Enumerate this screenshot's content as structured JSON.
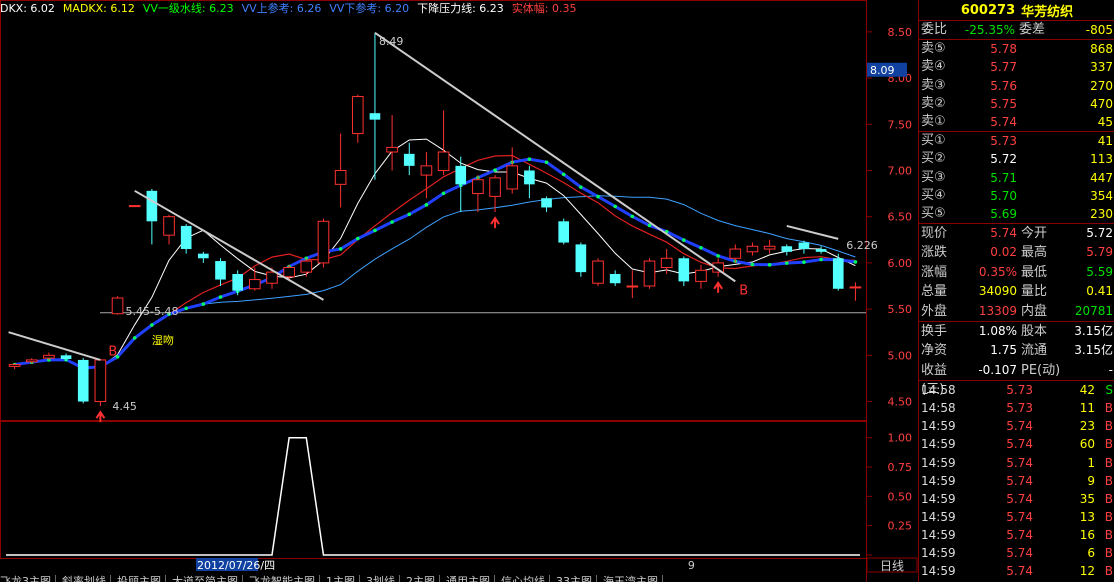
{
  "indicators": [
    {
      "label": "DKX: 6.02",
      "color": "#ffffff"
    },
    {
      "label": "MADKX: 6.12",
      "color": "#ffff00"
    },
    {
      "label": "VV一级水线: 6.23",
      "color": "#00ff00"
    },
    {
      "label": "VV上参考: 6.26",
      "color": "#4080ff"
    },
    {
      "label": "VV下参考: 6.20",
      "color": "#4080ff"
    },
    {
      "label": "下降压力线: 6.23",
      "color": "#ffffff"
    },
    {
      "label": "实体幅: 0.35",
      "color": "#ff4040"
    }
  ],
  "chart_data": {
    "type": "candlestick",
    "y_axis_ticks": [
      "8.50",
      "8.00",
      "7.50",
      "7.00",
      "6.50",
      "6.00",
      "5.50",
      "5.00",
      "4.50"
    ],
    "ylim": [
      4.3,
      8.65
    ],
    "current_price_marker": "8.09",
    "candles": [
      {
        "o": 4.88,
        "c": 4.9,
        "h": 4.91,
        "l": 4.85
      },
      {
        "o": 4.93,
        "c": 4.95,
        "h": 4.97,
        "l": 4.91
      },
      {
        "o": 4.97,
        "c": 5.0,
        "h": 5.03,
        "l": 4.95
      },
      {
        "o": 5.0,
        "c": 4.96,
        "h": 5.02,
        "l": 4.94
      },
      {
        "o": 4.95,
        "c": 4.5,
        "h": 4.97,
        "l": 4.48
      },
      {
        "o": 4.5,
        "c": 4.95,
        "h": 4.96,
        "l": 4.45
      },
      {
        "o": 5.45,
        "c": 5.62,
        "h": 5.64,
        "l": 5.44
      },
      {
        "o": 6.62,
        "c": 6.62,
        "h": 6.62,
        "l": 6.62
      },
      {
        "o": 6.78,
        "c": 6.45,
        "h": 6.8,
        "l": 6.2
      },
      {
        "o": 6.3,
        "c": 6.5,
        "h": 6.52,
        "l": 6.2
      },
      {
        "o": 6.4,
        "c": 6.15,
        "h": 6.42,
        "l": 6.1
      },
      {
        "o": 6.1,
        "c": 6.05,
        "h": 6.12,
        "l": 6.0
      },
      {
        "o": 6.02,
        "c": 5.82,
        "h": 6.05,
        "l": 5.75
      },
      {
        "o": 5.88,
        "c": 5.7,
        "h": 5.92,
        "l": 5.65
      },
      {
        "o": 5.72,
        "c": 5.82,
        "h": 5.95,
        "l": 5.7
      },
      {
        "o": 5.78,
        "c": 5.9,
        "h": 5.95,
        "l": 5.72
      },
      {
        "o": 5.85,
        "c": 5.95,
        "h": 5.98,
        "l": 5.8
      },
      {
        "o": 5.9,
        "c": 6.02,
        "h": 6.05,
        "l": 5.85
      },
      {
        "o": 6.0,
        "c": 6.45,
        "h": 6.48,
        "l": 5.95
      },
      {
        "o": 6.85,
        "c": 7.0,
        "h": 7.4,
        "l": 6.6
      },
      {
        "o": 7.4,
        "c": 7.8,
        "h": 7.82,
        "l": 7.3
      },
      {
        "o": 7.62,
        "c": 7.55,
        "h": 8.49,
        "l": 6.9
      },
      {
        "o": 7.2,
        "c": 7.25,
        "h": 7.6,
        "l": 7.0
      },
      {
        "o": 7.18,
        "c": 7.05,
        "h": 7.3,
        "l": 6.95
      },
      {
        "o": 6.95,
        "c": 7.05,
        "h": 7.2,
        "l": 6.7
      },
      {
        "o": 7.0,
        "c": 7.2,
        "h": 7.65,
        "l": 6.95
      },
      {
        "o": 7.05,
        "c": 6.85,
        "h": 7.15,
        "l": 6.55
      },
      {
        "o": 6.75,
        "c": 6.9,
        "h": 6.95,
        "l": 6.55
      },
      {
        "o": 6.72,
        "c": 6.92,
        "h": 6.95,
        "l": 6.55
      },
      {
        "o": 6.8,
        "c": 7.05,
        "h": 7.25,
        "l": 6.75
      },
      {
        "o": 7.0,
        "c": 6.85,
        "h": 7.05,
        "l": 6.7
      },
      {
        "o": 6.7,
        "c": 6.6,
        "h": 6.72,
        "l": 6.55
      },
      {
        "o": 6.45,
        "c": 6.22,
        "h": 6.48,
        "l": 6.2
      },
      {
        "o": 6.2,
        "c": 5.9,
        "h": 6.22,
        "l": 5.85
      },
      {
        "o": 5.78,
        "c": 6.02,
        "h": 6.05,
        "l": 5.75
      },
      {
        "o": 5.88,
        "c": 5.78,
        "h": 5.92,
        "l": 5.75
      },
      {
        "o": 5.75,
        "c": 5.75,
        "h": 5.92,
        "l": 5.62
      },
      {
        "o": 5.75,
        "c": 6.02,
        "h": 6.05,
        "l": 5.72
      },
      {
        "o": 5.95,
        "c": 6.05,
        "h": 6.15,
        "l": 5.88
      },
      {
        "o": 6.05,
        "c": 5.8,
        "h": 6.07,
        "l": 5.75
      },
      {
        "o": 5.8,
        "c": 5.92,
        "h": 5.98,
        "l": 5.72
      },
      {
        "o": 5.9,
        "c": 6.0,
        "h": 6.05,
        "l": 5.85
      },
      {
        "o": 6.05,
        "c": 6.15,
        "h": 6.2,
        "l": 6.0
      },
      {
        "o": 6.12,
        "c": 6.18,
        "h": 6.22,
        "l": 6.08
      },
      {
        "o": 6.15,
        "c": 6.18,
        "h": 6.25,
        "l": 6.1
      },
      {
        "o": 6.18,
        "c": 6.12,
        "h": 6.2,
        "l": 6.08
      },
      {
        "o": 6.22,
        "c": 6.15,
        "h": 6.24,
        "l": 6.1
      },
      {
        "o": 6.15,
        "c": 6.12,
        "h": 6.18,
        "l": 6.1
      },
      {
        "o": 6.05,
        "c": 5.72,
        "h": 6.1,
        "l": 5.7
      },
      {
        "o": 5.74,
        "c": 5.74,
        "h": 5.79,
        "l": 5.59
      }
    ],
    "annotations": {
      "high_label": "8.49",
      "low_label": "4.45",
      "range_label": "5.45-5.48",
      "note_label": "湿吻",
      "line_end_label": "6.226",
      "signal_label": "B"
    },
    "lower_panel": {
      "y_axis_ticks": [
        "1.00",
        "0.75",
        "0.50",
        "0.25",
        "0.00"
      ],
      "ylim": [
        0,
        1.1
      ],
      "pulse": {
        "start": 15,
        "peak_start": 16,
        "peak_end": 17,
        "end": 18
      }
    },
    "x_date_label": "2012/07/26/四",
    "x_month_label": "9",
    "period_label": "日线"
  },
  "quote": {
    "code": "600273",
    "name": "华芳纺织",
    "weibi_label": "委比",
    "weibi_value": "-25.35%",
    "weicha_label": "委差",
    "weicha_value": "-805",
    "asks": [
      {
        "label": "卖⑤",
        "price": "5.78",
        "vol": "868"
      },
      {
        "label": "卖④",
        "price": "5.77",
        "vol": "337"
      },
      {
        "label": "卖③",
        "price": "5.76",
        "vol": "270"
      },
      {
        "label": "卖②",
        "price": "5.75",
        "vol": "470"
      },
      {
        "label": "卖①",
        "price": "5.74",
        "vol": "45"
      }
    ],
    "bids": [
      {
        "label": "买①",
        "price": "5.73",
        "vol": "41",
        "color": "red"
      },
      {
        "label": "买②",
        "price": "5.72",
        "vol": "113",
        "color": "white"
      },
      {
        "label": "买③",
        "price": "5.71",
        "vol": "447",
        "color": "green"
      },
      {
        "label": "买④",
        "price": "5.70",
        "vol": "354",
        "color": "green"
      },
      {
        "label": "买⑤",
        "price": "5.69",
        "vol": "230",
        "color": "green"
      }
    ],
    "stats": [
      {
        "l1": "现价",
        "v1": "5.74",
        "c1": "red",
        "l2": "今开",
        "v2": "5.72",
        "c2": "white"
      },
      {
        "l1": "涨跌",
        "v1": "0.02",
        "c1": "red",
        "l2": "最高",
        "v2": "5.79",
        "c2": "red"
      },
      {
        "l1": "涨幅",
        "v1": "0.35%",
        "c1": "red",
        "l2": "最低",
        "v2": "5.59",
        "c2": "green"
      },
      {
        "l1": "总量",
        "v1": "34090",
        "c1": "yellow",
        "l2": "量比",
        "v2": "0.41",
        "c2": "yellow"
      },
      {
        "l1": "外盘",
        "v1": "13309",
        "c1": "red",
        "l2": "内盘",
        "v2": "20781",
        "c2": "green"
      }
    ],
    "stats2": [
      {
        "l1": "换手",
        "v1": "1.08%",
        "c1": "white",
        "l2": "股本",
        "v2": "3.15亿",
        "c2": "white"
      },
      {
        "l1": "净资",
        "v1": "1.75",
        "c1": "white",
        "l2": "流通",
        "v2": "3.15亿",
        "c2": "white"
      },
      {
        "l1": "收益(三)",
        "v1": "-0.107",
        "c1": "white",
        "l2": "PE(动)",
        "v2": "-",
        "c2": "white"
      }
    ],
    "ticks": [
      {
        "t": "14:58",
        "p": "5.73",
        "v": "42",
        "d": "S",
        "dc": "green"
      },
      {
        "t": "14:58",
        "p": "5.73",
        "v": "11",
        "d": "B",
        "dc": "red"
      },
      {
        "t": "14:59",
        "p": "5.74",
        "v": "23",
        "d": "B",
        "dc": "red"
      },
      {
        "t": "14:59",
        "p": "5.74",
        "v": "60",
        "d": "B",
        "dc": "red"
      },
      {
        "t": "14:59",
        "p": "5.74",
        "v": "1",
        "d": "B",
        "dc": "red"
      },
      {
        "t": "14:59",
        "p": "5.74",
        "v": "9",
        "d": "B",
        "dc": "red"
      },
      {
        "t": "14:59",
        "p": "5.74",
        "v": "35",
        "d": "B",
        "dc": "red"
      },
      {
        "t": "14:59",
        "p": "5.74",
        "v": "13",
        "d": "B",
        "dc": "red"
      },
      {
        "t": "14:59",
        "p": "5.74",
        "v": "16",
        "d": "B",
        "dc": "red"
      },
      {
        "t": "14:59",
        "p": "5.74",
        "v": "6",
        "d": "B",
        "dc": "red"
      },
      {
        "t": "14:59",
        "p": "5.74",
        "v": "12",
        "d": "B",
        "dc": "red"
      }
    ]
  },
  "bottom_tabs": [
    "飞龙3主图",
    "斜率划线",
    "投顾主图",
    "大道至简主图",
    "飞龙智能主图",
    "1主图",
    "3划线",
    "2主图",
    "通用主图",
    "信心均线",
    "33主图",
    "海王湾主图"
  ],
  "colors": {
    "up": "#ff3030",
    "down": "#54ffff",
    "ma_white": "#ffffff",
    "ma_red": "#e02020",
    "ma_blue": "#3ca0ff",
    "grid_red": "#8b0000"
  }
}
